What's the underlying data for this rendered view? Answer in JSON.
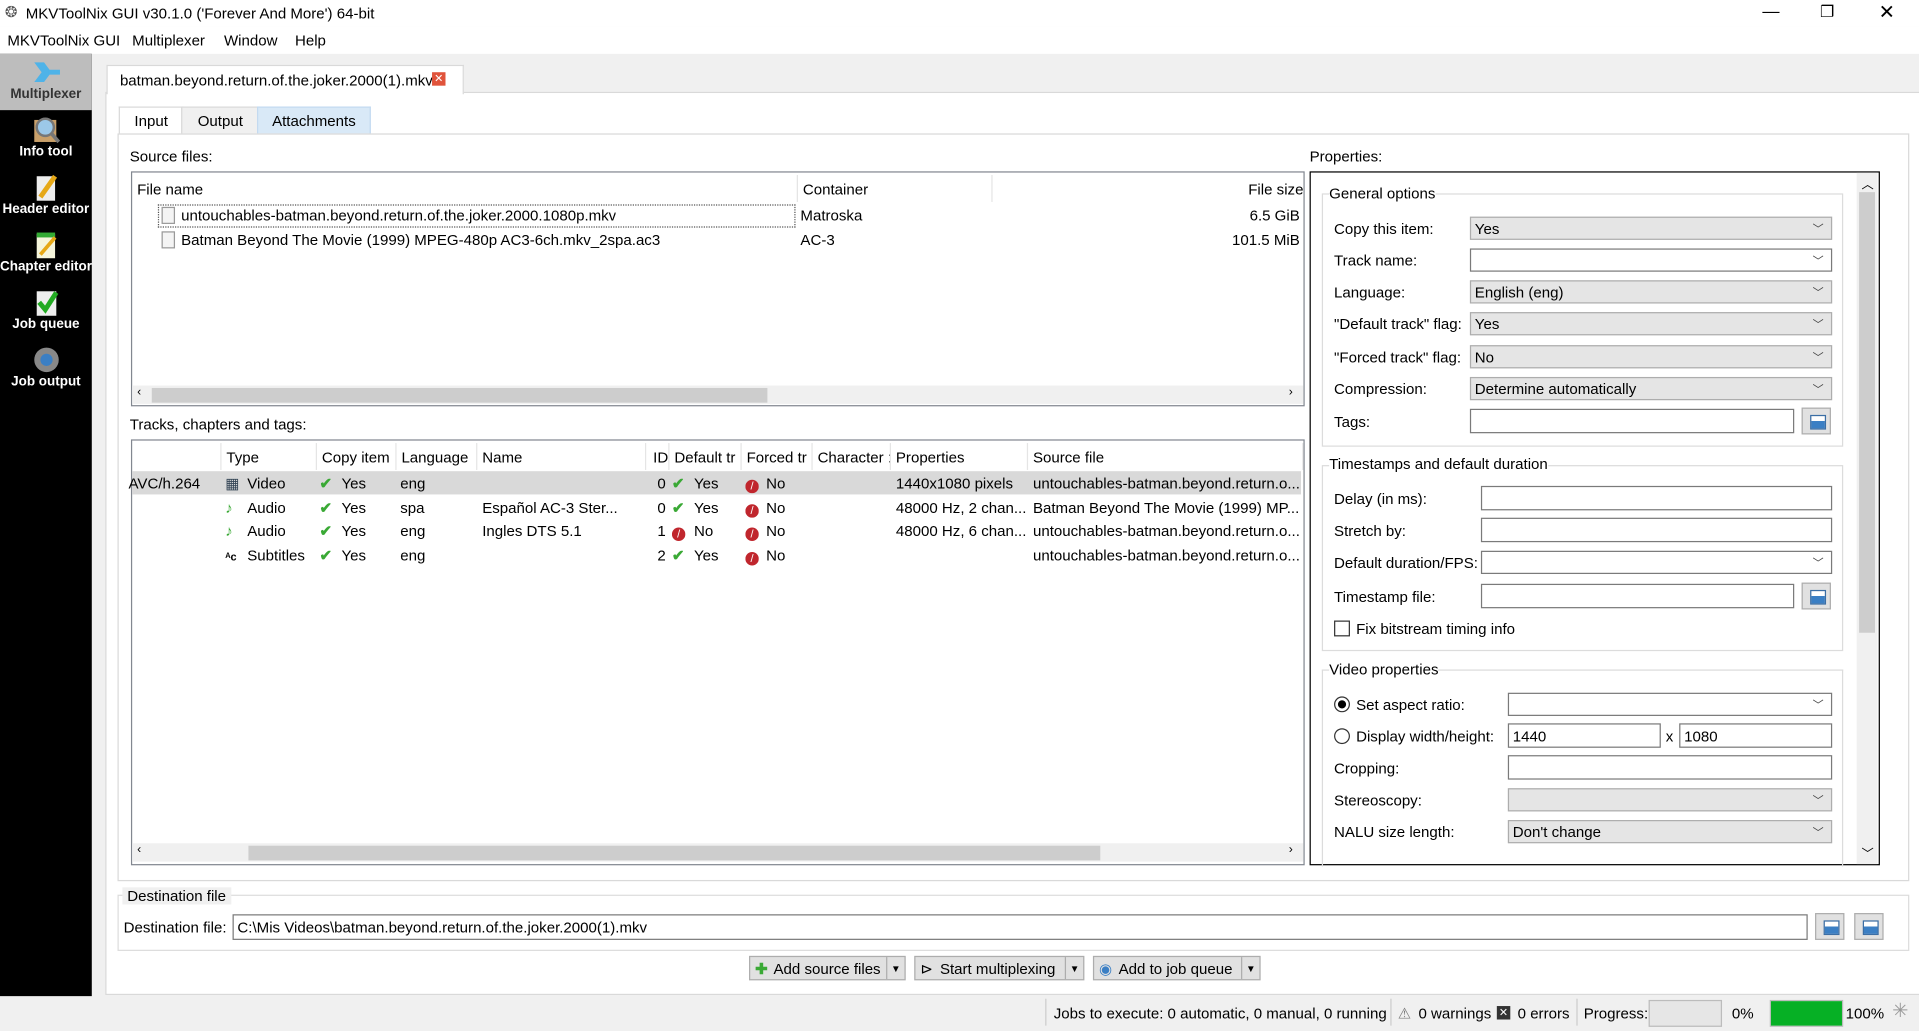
{
  "window": {
    "title": "MKVToolNix GUI v30.1.0 ('Forever And More') 64-bit"
  },
  "menu": [
    "MKVToolNix GUI",
    "Multiplexer",
    "Window",
    "Help"
  ],
  "sidebar": [
    {
      "label": "Multiplexer",
      "icon": "multiplexer-icon"
    },
    {
      "label": "Info tool",
      "icon": "info-tool-icon"
    },
    {
      "label": "Header editor",
      "icon": "header-editor-icon"
    },
    {
      "label": "Chapter editor",
      "icon": "chapter-editor-icon"
    },
    {
      "label": "Job queue",
      "icon": "job-queue-icon"
    },
    {
      "label": "Job output",
      "icon": "job-output-icon"
    }
  ],
  "file_tab": "batman.beyond.return.of.the.joker.2000(1).mkv",
  "tabs": [
    "Input",
    "Output",
    "Attachments"
  ],
  "source": {
    "label": "Source files:",
    "headers": [
      "File name",
      "Container",
      "File size"
    ],
    "rows": [
      [
        "untouchables-batman.beyond.return.of.the.joker.2000.1080p.mkv",
        "Matroska",
        "6.5 GiB"
      ],
      [
        "Batman Beyond The Movie (1999) MPEG-480p AC3-6ch.mkv_2spa.ac3",
        "AC-3",
        "101.5 MiB"
      ]
    ]
  },
  "tracks": {
    "label": "Tracks, chapters and tags:",
    "headers": [
      "Type",
      "Copy item",
      "Language",
      "Name",
      "ID",
      "Default tr",
      "Forced tr",
      "Character :",
      "Properties",
      "Source file"
    ],
    "rows": [
      {
        "codec": "AVC/h.264",
        "type": "Video",
        "copy": "Yes",
        "lang": "eng",
        "name": "",
        "id": "0",
        "def": "Yes",
        "forced": "No",
        "props": "1440x1080 pixels",
        "src": "untouchables-batman.beyond.return.o..."
      },
      {
        "codec": "",
        "type": "Audio",
        "copy": "Yes",
        "lang": "spa",
        "name": "Español AC-3 Ster...",
        "id": "0",
        "def": "Yes",
        "forced": "No",
        "props": "48000 Hz, 2 chan...",
        "src": "Batman Beyond The Movie (1999) MP..."
      },
      {
        "codec": "",
        "type": "Audio",
        "copy": "Yes",
        "lang": "eng",
        "name": "Ingles DTS 5.1",
        "id": "1",
        "def": "No",
        "forced": "No",
        "props": "48000 Hz, 6 chan...",
        "src": "untouchables-batman.beyond.return.o..."
      },
      {
        "codec": "",
        "type": "Subtitles",
        "copy": "Yes",
        "lang": "eng",
        "name": "",
        "id": "2",
        "def": "Yes",
        "forced": "No",
        "props": "",
        "src": "untouchables-batman.beyond.return.o..."
      }
    ]
  },
  "properties": {
    "label": "Properties:",
    "general": {
      "title": "General options",
      "copy": {
        "label": "Copy this item:",
        "value": "Yes"
      },
      "track_name": {
        "label": "Track name:",
        "value": ""
      },
      "language": {
        "label": "Language:",
        "value": "English (eng)"
      },
      "default_flag": {
        "label": "\"Default track\" flag:",
        "value": "Yes"
      },
      "forced_flag": {
        "label": "\"Forced track\" flag:",
        "value": "No"
      },
      "compression": {
        "label": "Compression:",
        "value": "Determine automatically"
      },
      "tags": {
        "label": "Tags:",
        "value": ""
      }
    },
    "timestamps": {
      "title": "Timestamps and default duration",
      "delay": "Delay (in ms):",
      "stretch": "Stretch by:",
      "duration": "Default duration/FPS:",
      "file": "Timestamp file:",
      "fix": "Fix bitstream timing info"
    },
    "video": {
      "title": "Video properties",
      "aspect": "Set aspect ratio:",
      "display": "Display width/height:",
      "width": "1440",
      "x": "x",
      "height": "1080",
      "cropping": "Cropping:",
      "stereo": "Stereoscopy:",
      "nalu": "NALU size length:",
      "nalu_value": "Don't change"
    }
  },
  "destination": {
    "group": "Destination file",
    "label": "Destination file:",
    "value": "C:\\Mis Videos\\batman.beyond.return.of.the.joker.2000(1).mkv"
  },
  "buttons": {
    "add": "Add source files",
    "start": "Start multiplexing",
    "queue": "Add to job queue"
  },
  "status": {
    "jobs": "Jobs to execute: 0 automatic, 0 manual, 0 running",
    "warnings": "0 warnings",
    "errors": "0 errors",
    "progress_label": "Progress:",
    "progress1": "0%",
    "progress2": "100%",
    "progress1_value": 0,
    "progress2_value": 100
  },
  "colors": {
    "progress": "#06b025",
    "check": "#3aa935",
    "no": "#c0262d"
  }
}
